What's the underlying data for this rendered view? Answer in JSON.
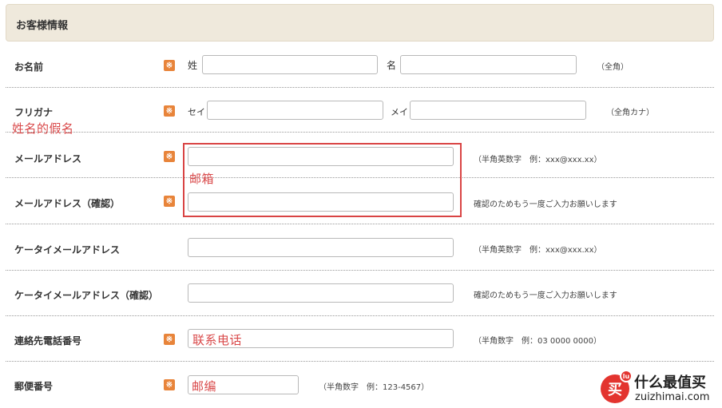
{
  "section_title": "お客様情報",
  "required_mark": "※",
  "rows": {
    "name": {
      "label": "お名前",
      "sei_label": "姓",
      "mei_label": "名",
      "sei_value": "",
      "mei_value": "",
      "hint": "（全角）"
    },
    "furigana": {
      "label": "フリガナ",
      "sei_label": "セイ",
      "mei_label": "メイ",
      "sei_value": "",
      "mei_value": "",
      "hint": "（全角カナ）"
    },
    "email": {
      "label": "メールアドレス",
      "value": "",
      "hint": "（半角英数字　例：xxx@xxx.xx）"
    },
    "email_confirm": {
      "label": "メールアドレス（確認）",
      "value": "",
      "hint": "確認のためもう一度ご入力お願いします"
    },
    "mobile_email": {
      "label": "ケータイメールアドレス",
      "value": "",
      "hint": "（半角英数字　例：xxx@xxx.xx）"
    },
    "mobile_email_confirm": {
      "label": "ケータイメールアドレス（確認）",
      "value": "",
      "hint": "確認のためもう一度ご入力お願いします"
    },
    "phone": {
      "label": "連絡先電話番号",
      "value": "",
      "hint": "（半角数字　例：03 0000 0000）"
    },
    "postal": {
      "label": "郵便番号",
      "value": "",
      "hint": "（半角数字　例：123-4567）"
    }
  },
  "annotations": {
    "furigana_note": "姓名的假名",
    "email_note": "邮箱",
    "phone_note": "联系电话",
    "postal_note": "邮编",
    "color": "#d9494a"
  },
  "watermark": {
    "badge": "买",
    "badge_small": "lu",
    "title": "什么最值买",
    "url": "zuizhimai.com"
  },
  "colors": {
    "header_bg": "#efe9dc",
    "required_bg": "#e8843a",
    "separator": "#999999"
  }
}
